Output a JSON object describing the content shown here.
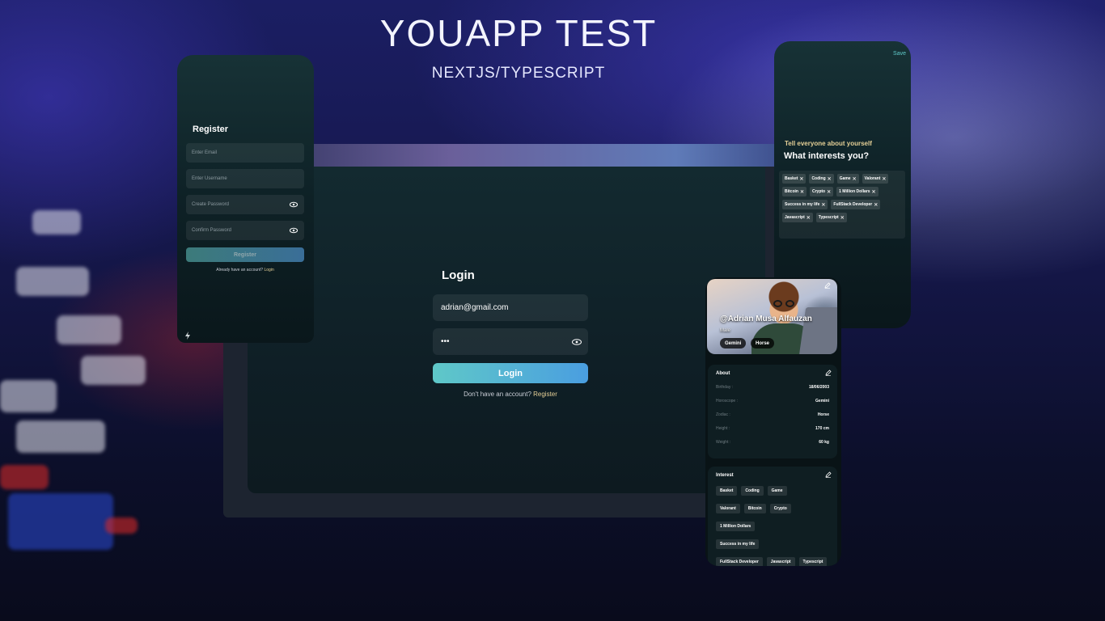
{
  "hero": {
    "title": "YOUAPP TEST",
    "subtitle": "NEXTJS/TYPESCRIPT"
  },
  "login": {
    "title": "Login",
    "email_value": "adrian@gmail.com",
    "password_value": "•••",
    "button": "Login",
    "footer_text": "Don't have an account?",
    "footer_link": "Register"
  },
  "register": {
    "title": "Register",
    "email_placeholder": "Enter Email",
    "username_placeholder": "Enter Username",
    "password_placeholder": "Create Password",
    "confirm_placeholder": "Confirm Password",
    "button": "Register",
    "footer_text": "Already have an account?",
    "footer_link": "Login"
  },
  "interests_editor": {
    "save": "Save",
    "subtitle": "Tell everyone about yourself",
    "title": "What interests you?",
    "tags": [
      "Basket",
      "Coding",
      "Game",
      "Valorant",
      "Bitcoin",
      "Crypto",
      "1 Million Dollars",
      "Success in my life",
      "FullStack Developer",
      "Javascript",
      "Typescript"
    ]
  },
  "profile": {
    "handle": "@Adrian Musa Alfauzan",
    "gender": "Male",
    "horoscope_pill": "Gemini",
    "zodiac_pill": "Horse",
    "about": {
      "title": "About",
      "rows": [
        {
          "label": "Birthday :",
          "value": "18/06/2003"
        },
        {
          "label": "Horoscope :",
          "value": "Gemini"
        },
        {
          "label": "Zodiac :",
          "value": "Horse"
        },
        {
          "label": "Height :",
          "value": "170 cm"
        },
        {
          "label": "Weight :",
          "value": "60 kg"
        }
      ]
    },
    "interest": {
      "title": "Interest",
      "tags": [
        "Basket",
        "Coding",
        "Game",
        "Valorant",
        "Bitcoin",
        "Crypto",
        "1 Million Dollars",
        "Success in my life",
        "FullStack Developer",
        "Javascript",
        "Typescript"
      ]
    }
  },
  "colors": {
    "accent_teal": "#5fc8c8",
    "accent_blue": "#4a9ee0",
    "gold": "#e4cf96"
  }
}
